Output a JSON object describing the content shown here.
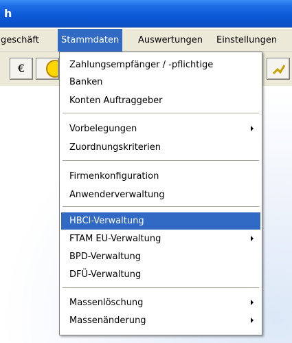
{
  "window": {
    "title_fragment": "h"
  },
  "menubar": {
    "items": [
      {
        "label": "geschäft"
      },
      {
        "label": "Stammdaten"
      },
      {
        "label": "Auswertungen"
      },
      {
        "label": "Einstellungen"
      }
    ]
  },
  "toolbar": {
    "buttons": [
      {
        "icon": "euro-icon",
        "glyph": "€"
      },
      {
        "icon": "coin-icon"
      },
      {
        "icon": "edit-icon"
      }
    ]
  },
  "menu": {
    "items": [
      {
        "label": "Zahlungsempfänger / -pflichtige"
      },
      {
        "label": "Banken"
      },
      {
        "label": "Konten Auftraggeber"
      },
      {
        "label": "Vorbelegungen",
        "submenu": true
      },
      {
        "label": "Zuordnungskriterien"
      },
      {
        "label": "Firmenkonfiguration"
      },
      {
        "label": "Anwenderverwaltung"
      },
      {
        "label": "HBCI-Verwaltung",
        "highlighted": true
      },
      {
        "label": "FTAM EU-Verwaltung",
        "submenu": true
      },
      {
        "label": "BPD-Verwaltung"
      },
      {
        "label": "DFÜ-Verwaltung"
      },
      {
        "label": "Massenlöschung",
        "submenu": true
      },
      {
        "label": "Massenänderung",
        "submenu": true
      }
    ]
  },
  "colors": {
    "titlebar": "#0c58d6",
    "highlight": "#316ac5",
    "menu_bg": "#ece9d8"
  }
}
